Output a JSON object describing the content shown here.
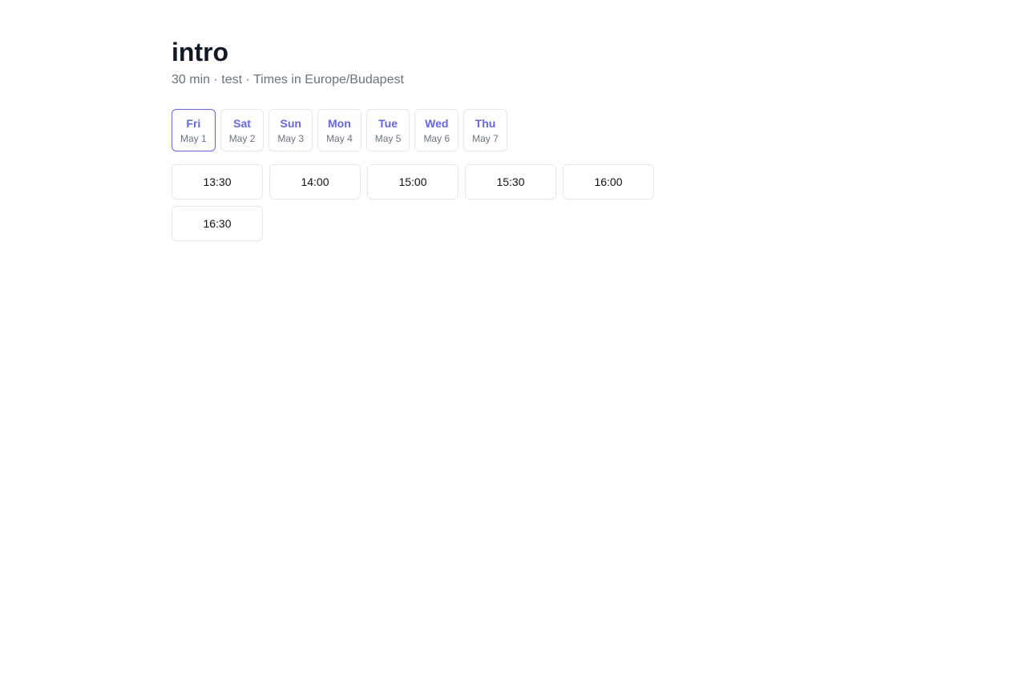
{
  "event": {
    "title": "intro",
    "subtitle": "30 min · test · Times in Europe/Budapest"
  },
  "days": [
    {
      "name": "Fri",
      "date": "May 1",
      "selected": true
    },
    {
      "name": "Sat",
      "date": "May 2",
      "selected": false
    },
    {
      "name": "Sun",
      "date": "May 3",
      "selected": false
    },
    {
      "name": "Mon",
      "date": "May 4",
      "selected": false
    },
    {
      "name": "Tue",
      "date": "May 5",
      "selected": false
    },
    {
      "name": "Wed",
      "date": "May 6",
      "selected": false
    },
    {
      "name": "Thu",
      "date": "May 7",
      "selected": false
    }
  ],
  "slots": [
    "13:30",
    "14:00",
    "15:00",
    "15:30",
    "16:00",
    "16:30"
  ],
  "colors": {
    "accent": "#6366f1",
    "border": "#e5e7eb",
    "title": "#111827",
    "muted": "#6b7280"
  }
}
